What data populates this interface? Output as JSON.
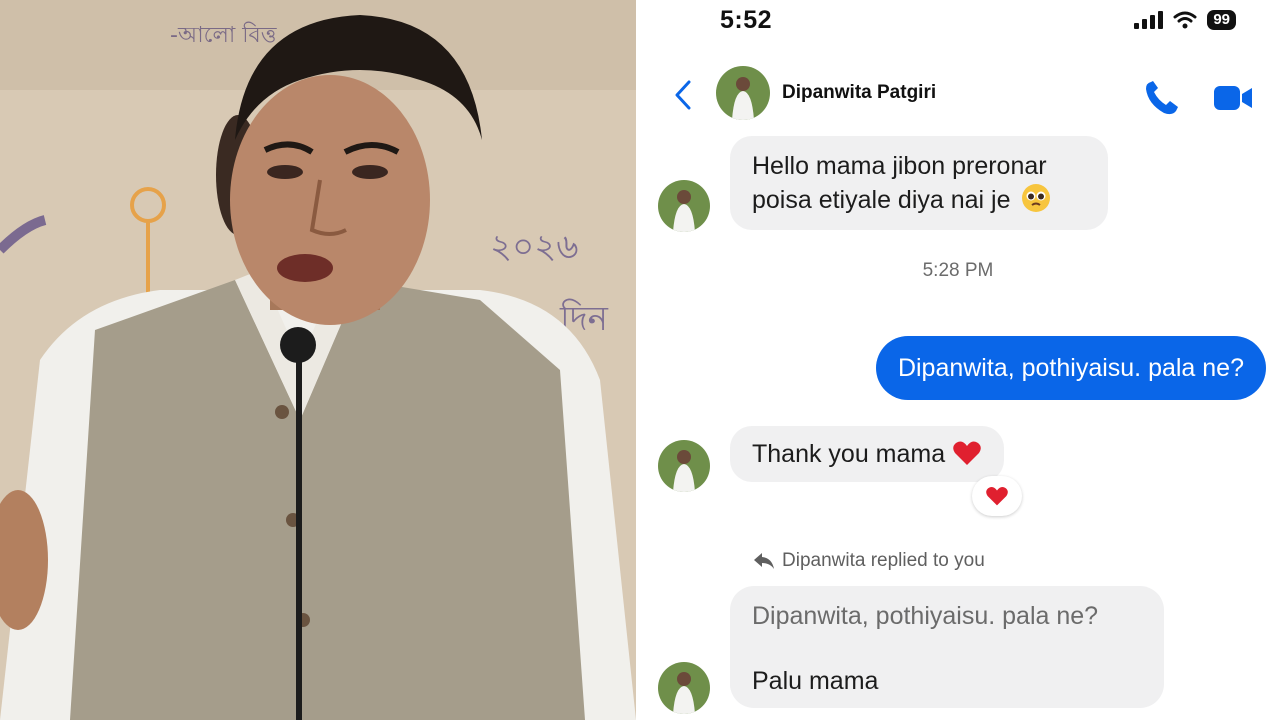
{
  "status_bar": {
    "time": "5:52",
    "battery": "99"
  },
  "header": {
    "contact_name": "Dipanwita Patgiri"
  },
  "messages": {
    "first_line1": "Hello mama jibon preronar",
    "first_line2": "poisa etiyale diya nai je",
    "timestamp": "5:28 PM",
    "outgoing": "Dipanwita, pothiyaisu. pala ne?",
    "thanks": "Thank you mama",
    "reply_note": "Dipanwita replied to you",
    "reply_quote": "Dipanwita, pothiyaisu. pala ne?",
    "reply_text": "Palu mama"
  },
  "photo": {
    "backdrop_text_1": "-আলো বিত্ত",
    "backdrop_text_2": "২০২৬",
    "backdrop_text_3": "দিন"
  },
  "colors": {
    "accent": "#0a66e8",
    "bubble_gray": "#f0f0f1",
    "heart": "#e0202f"
  },
  "icons": [
    "back-chevron-icon",
    "phone-icon",
    "video-camera-icon",
    "reply-arrow-icon",
    "heart-icon",
    "pleading-face-emoji"
  ]
}
